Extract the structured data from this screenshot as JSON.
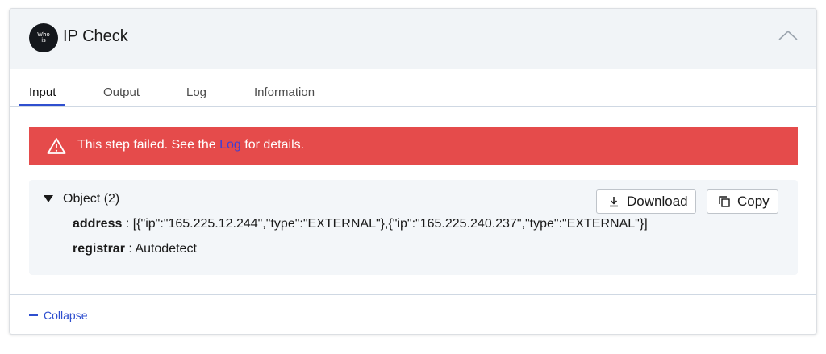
{
  "header": {
    "logo_line1": "Who",
    "logo_line2": "is",
    "title": "IP Check"
  },
  "tabs": [
    {
      "label": "Input",
      "active": true
    },
    {
      "label": "Output",
      "active": false
    },
    {
      "label": "Log",
      "active": false
    },
    {
      "label": "Information",
      "active": false
    }
  ],
  "alert": {
    "text_before": "This step failed. See the ",
    "link_text": "Log",
    "text_after": " for details.",
    "color": "#e54b4b"
  },
  "object": {
    "label": "Object (2)",
    "download_label": "Download",
    "copy_label": "Copy",
    "fields": [
      {
        "key": "address",
        "value": "[{\"ip\":\"165.225.12.244\",\"type\":\"EXTERNAL\"},{\"ip\":\"165.225.240.237\",\"type\":\"EXTERNAL\"}]"
      },
      {
        "key": "registrar",
        "value": "Autodetect"
      }
    ]
  },
  "footer": {
    "collapse_label": "Collapse"
  },
  "colors": {
    "accent": "#2f4fcf",
    "header_bg": "#f1f4f7"
  }
}
